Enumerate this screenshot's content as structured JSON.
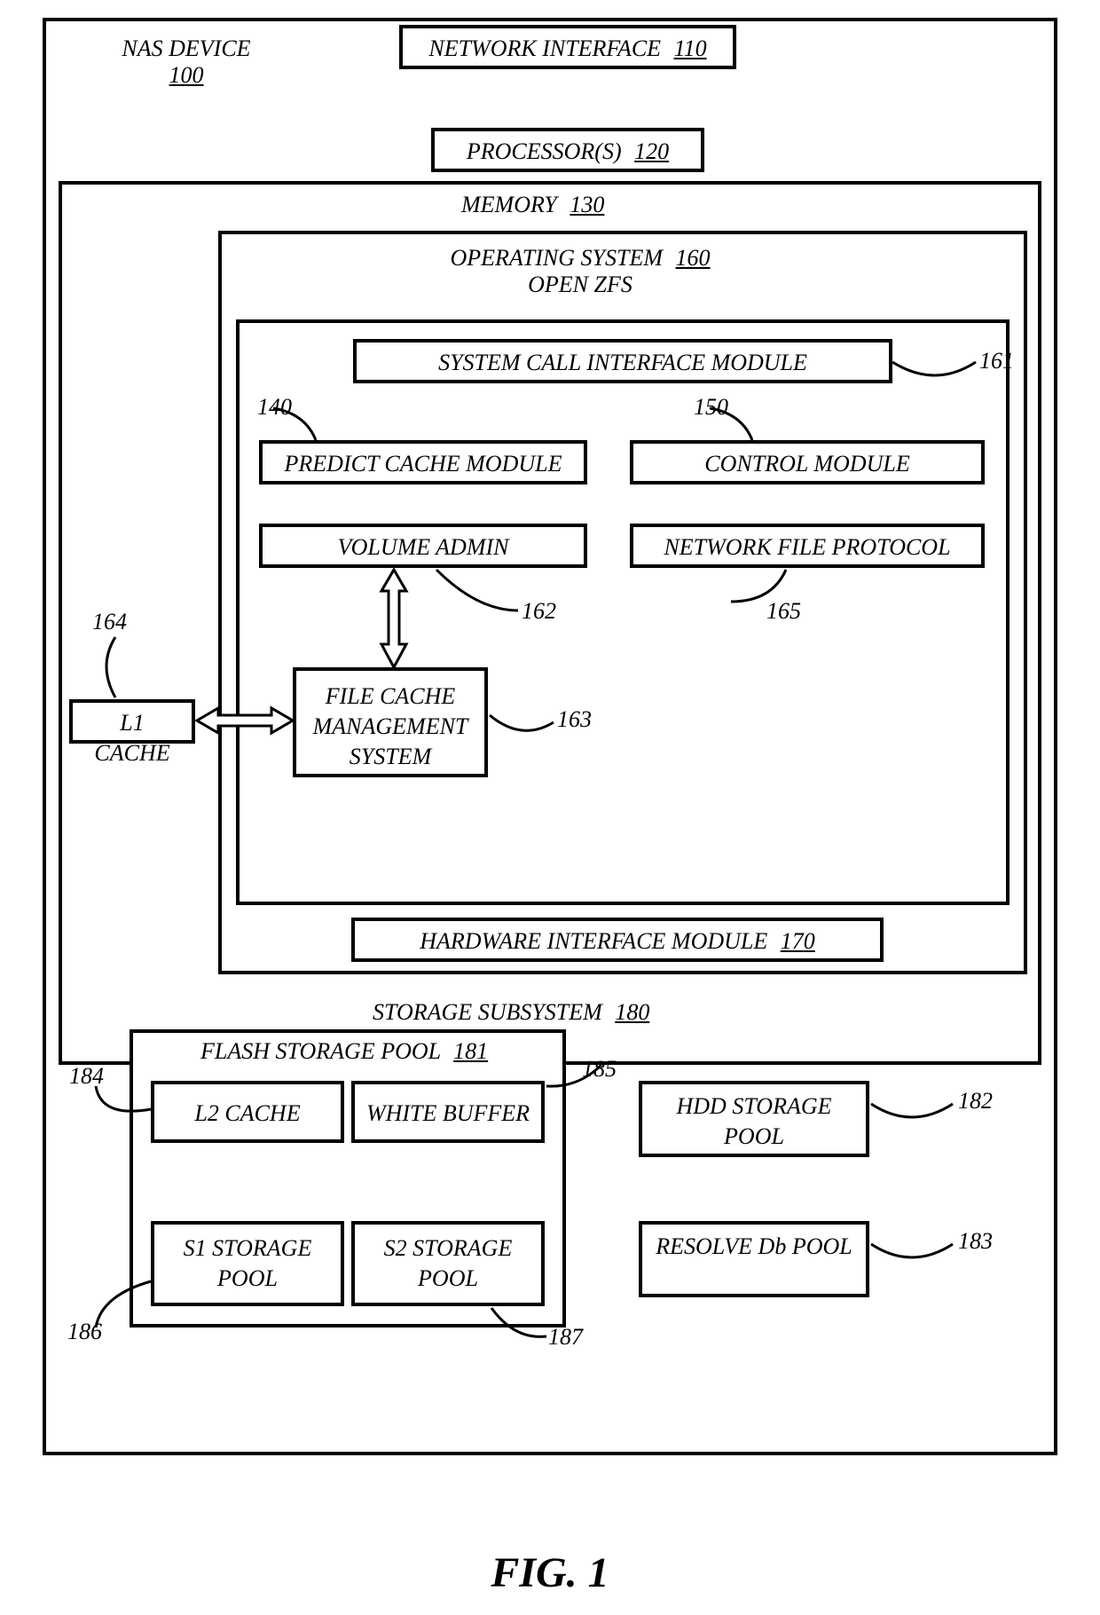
{
  "nas_device": {
    "label": "NAS DEVICE",
    "ref": "100"
  },
  "network_interface": {
    "label": "NETWORK INTERFACE",
    "ref": "110"
  },
  "processors": {
    "label": "PROCESSOR(S)",
    "ref": "120"
  },
  "memory": {
    "label": "MEMORY",
    "ref": "130"
  },
  "os": {
    "label": "OPERATING SYSTEM",
    "ref": "160",
    "subtitle": "OPEN ZFS"
  },
  "syscall": {
    "label": "SYSTEM CALL INTERFACE MODULE",
    "ref": "161"
  },
  "predict_cache": {
    "label": "PREDICT CACHE MODULE",
    "ref": "140"
  },
  "control_module": {
    "label": "CONTROL MODULE",
    "ref": "150"
  },
  "volume_admin": {
    "label": "VOLUME ADMIN",
    "ref": "162"
  },
  "network_file_protocol": {
    "label": "NETWORK FILE PROTOCOL",
    "ref": "165"
  },
  "l1_cache": {
    "label": "L1 CACHE",
    "ref": "164"
  },
  "file_cache_mgmt": {
    "label": "FILE CACHE MANAGEMENT SYSTEM",
    "ref": "163"
  },
  "hardware_interface": {
    "label": "HARDWARE INTERFACE MODULE",
    "ref": "170"
  },
  "storage_subsystem": {
    "label": "STORAGE SUBSYSTEM",
    "ref": "180"
  },
  "flash_pool": {
    "label": "FLASH STORAGE POOL",
    "ref": "181"
  },
  "l2_cache": {
    "label": "L2 CACHE",
    "ref": "184"
  },
  "white_buffer": {
    "label": "WHITE BUFFER",
    "ref": "185"
  },
  "s1_pool": {
    "label": "S1 STORAGE POOL",
    "ref": "186"
  },
  "s2_pool": {
    "label": "S2 STORAGE POOL",
    "ref": "187"
  },
  "hdd_pool": {
    "label": "HDD STORAGE POOL",
    "ref": "182"
  },
  "resolve_db": {
    "label": "RESOLVE Db POOL",
    "ref": "183"
  },
  "figure": "FIG. 1"
}
